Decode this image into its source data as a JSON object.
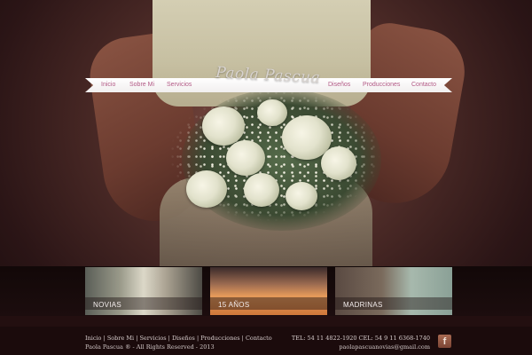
{
  "brand": {
    "logo_text": "Paola Pascua"
  },
  "nav": {
    "items": [
      {
        "label": "Inicio"
      },
      {
        "label": "Sobre Mi"
      },
      {
        "label": "Servicios"
      },
      {
        "label": "Diseños"
      },
      {
        "label": "Producciones"
      },
      {
        "label": "Contacto"
      }
    ]
  },
  "categories": [
    {
      "label": "NOVIAS"
    },
    {
      "label": "15 AÑOS"
    },
    {
      "label": "MADRINAS"
    }
  ],
  "footer": {
    "links": [
      "Inicio",
      "Sobre Mi",
      "Servicios",
      "Diseños",
      "Producciones",
      "Contacto"
    ],
    "separator": "|",
    "copyright": "Paola Pascua ® - All Rights Reserved - 2013",
    "phones": "TEL: 54 11 4822-1920 CEL: 54 9 11 6368-1740",
    "email": "paolapascuanovias@gmail.com",
    "social_icon": "facebook-icon",
    "social_glyph": "f"
  },
  "colors": {
    "nav_text": "#b35a86",
    "background": "#1e0f10",
    "facebook_icon": "#a86a52"
  }
}
